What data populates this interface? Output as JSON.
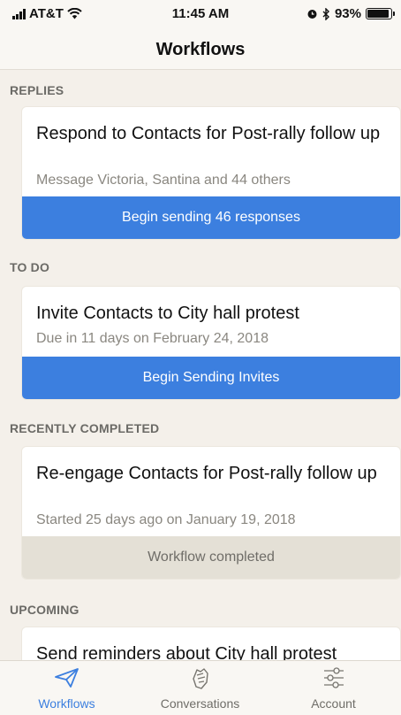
{
  "status_bar": {
    "carrier": "AT&T",
    "time": "11:45 AM",
    "battery": "93%",
    "battery_level": 0.93
  },
  "nav": {
    "title": "Workflows"
  },
  "sections": [
    {
      "label": "REPLIES",
      "card": {
        "title": "Respond to Contacts for Post-rally follow up",
        "subtitle": "Message Victoria, Santina and 44 others",
        "action": "Begin sending 46 responses"
      }
    },
    {
      "label": "TO DO",
      "card": {
        "title": "Invite Contacts to City hall protest",
        "subtitle": "Due in 11 days on February 24, 2018",
        "action": "Begin Sending Invites"
      }
    },
    {
      "label": "RECENTLY COMPLETED",
      "card": {
        "title": "Re-engage Contacts for Post-rally follow up",
        "subtitle": "Started 25 days ago on January 19, 2018",
        "action": "Workflow completed"
      }
    },
    {
      "label": "UPCOMING",
      "card": {
        "title": "Send reminders about City hall protest"
      }
    }
  ],
  "tabs": [
    {
      "label": "Workflows",
      "icon": "paper-plane-icon",
      "active": true
    },
    {
      "label": "Conversations",
      "icon": "handshake-icon",
      "active": false
    },
    {
      "label": "Account",
      "icon": "sliders-icon",
      "active": false
    }
  ],
  "colors": {
    "accent": "#3c7fdf",
    "background": "#f4f0ea",
    "completed": "#e4e0d6"
  }
}
